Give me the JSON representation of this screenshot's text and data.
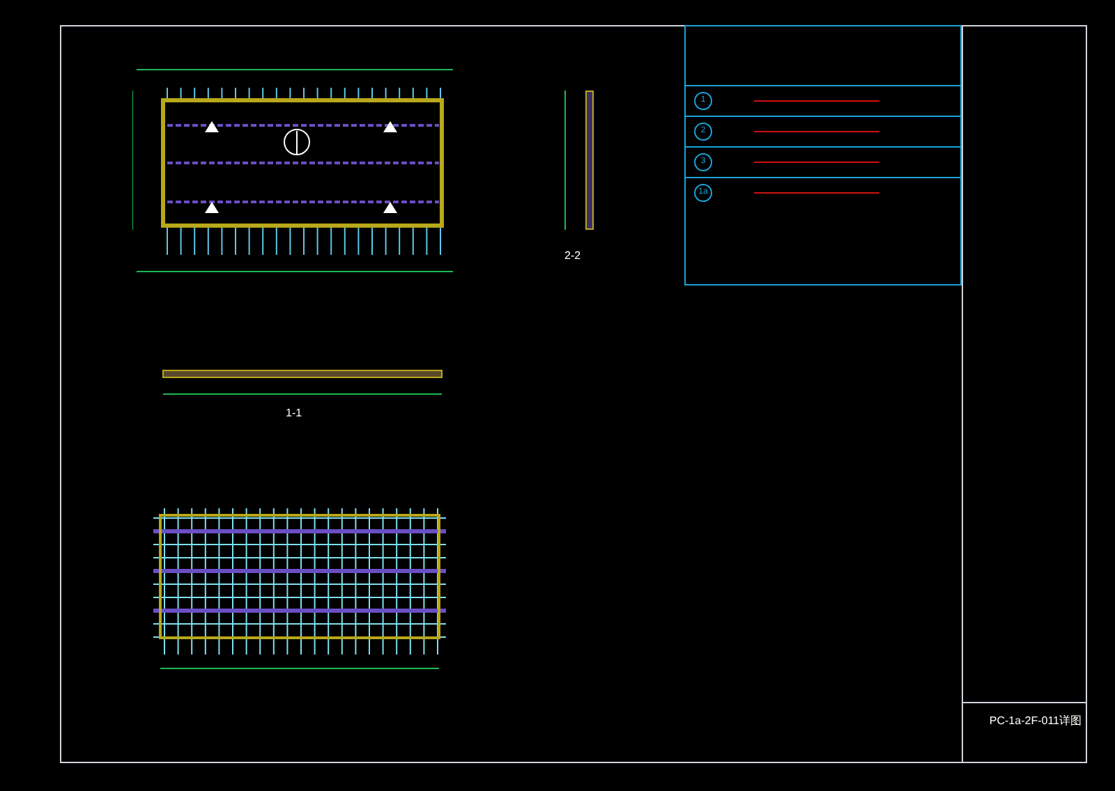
{
  "views": [
    {
      "kind": "section-side",
      "caption": "2-2"
    },
    {
      "kind": "section-long",
      "caption": "1-1"
    }
  ],
  "rebar_table": {
    "rows": [
      {
        "marker": "1"
      },
      {
        "marker": "2"
      },
      {
        "marker": "3"
      },
      {
        "marker": "1a"
      }
    ]
  },
  "title_block": {
    "drawing_number": "PC-1a-2F-011详图"
  }
}
